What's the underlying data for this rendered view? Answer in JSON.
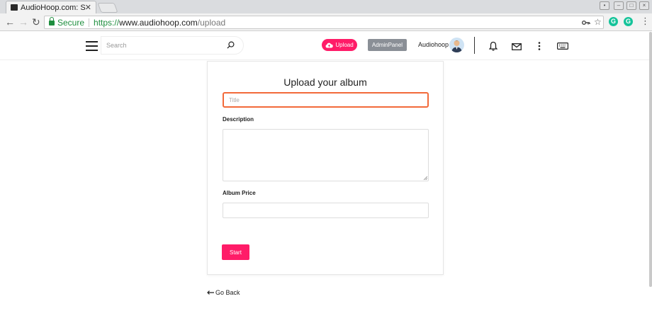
{
  "browser": {
    "tab_title": "AudioHoop.com: So",
    "tab_close": "✕",
    "secure_label": "Secure",
    "url_scheme": "https://",
    "url_host": "www.audiohoop.com",
    "url_path": "/upload"
  },
  "header": {
    "search_placeholder": "Search",
    "upload_label": "Upload",
    "admin_label": "AdminPanel",
    "username": "Audiohoop"
  },
  "form": {
    "heading": "Upload your album",
    "title_placeholder": "Title",
    "description_label": "Description",
    "price_label": "Album Price",
    "start_label": "Start"
  },
  "footer": {
    "go_back": "Go Back"
  },
  "colors": {
    "accent": "#ff1c68",
    "focus_border": "#f26a3a",
    "admin_button": "#8a8f96",
    "secure_green": "#1e8e3e"
  }
}
